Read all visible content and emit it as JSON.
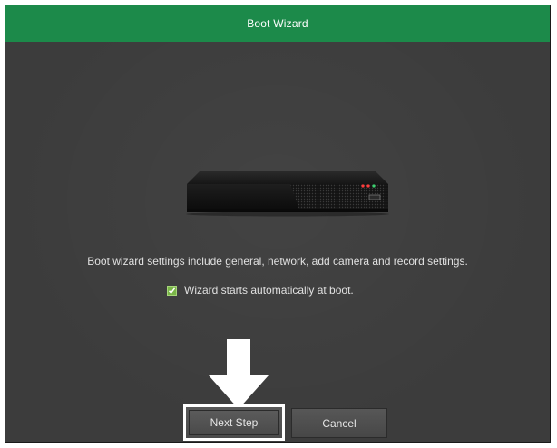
{
  "window": {
    "title": "Boot Wizard"
  },
  "wizard": {
    "description": "Boot wizard settings include general, network, add camera and record settings.",
    "autostart_label": "Wizard starts automatically at boot.",
    "autostart_checked": true
  },
  "buttons": {
    "next_label": "Next Step",
    "cancel_label": "Cancel"
  },
  "colors": {
    "title_bar": "#1c8a4a",
    "background": "#3c3c3c",
    "checkbox": "#7ab648",
    "highlight": "#ffffff"
  },
  "icons": {
    "device": "nvr-device-icon",
    "pointer": "down-arrow-icon",
    "check": "checkmark-icon"
  }
}
